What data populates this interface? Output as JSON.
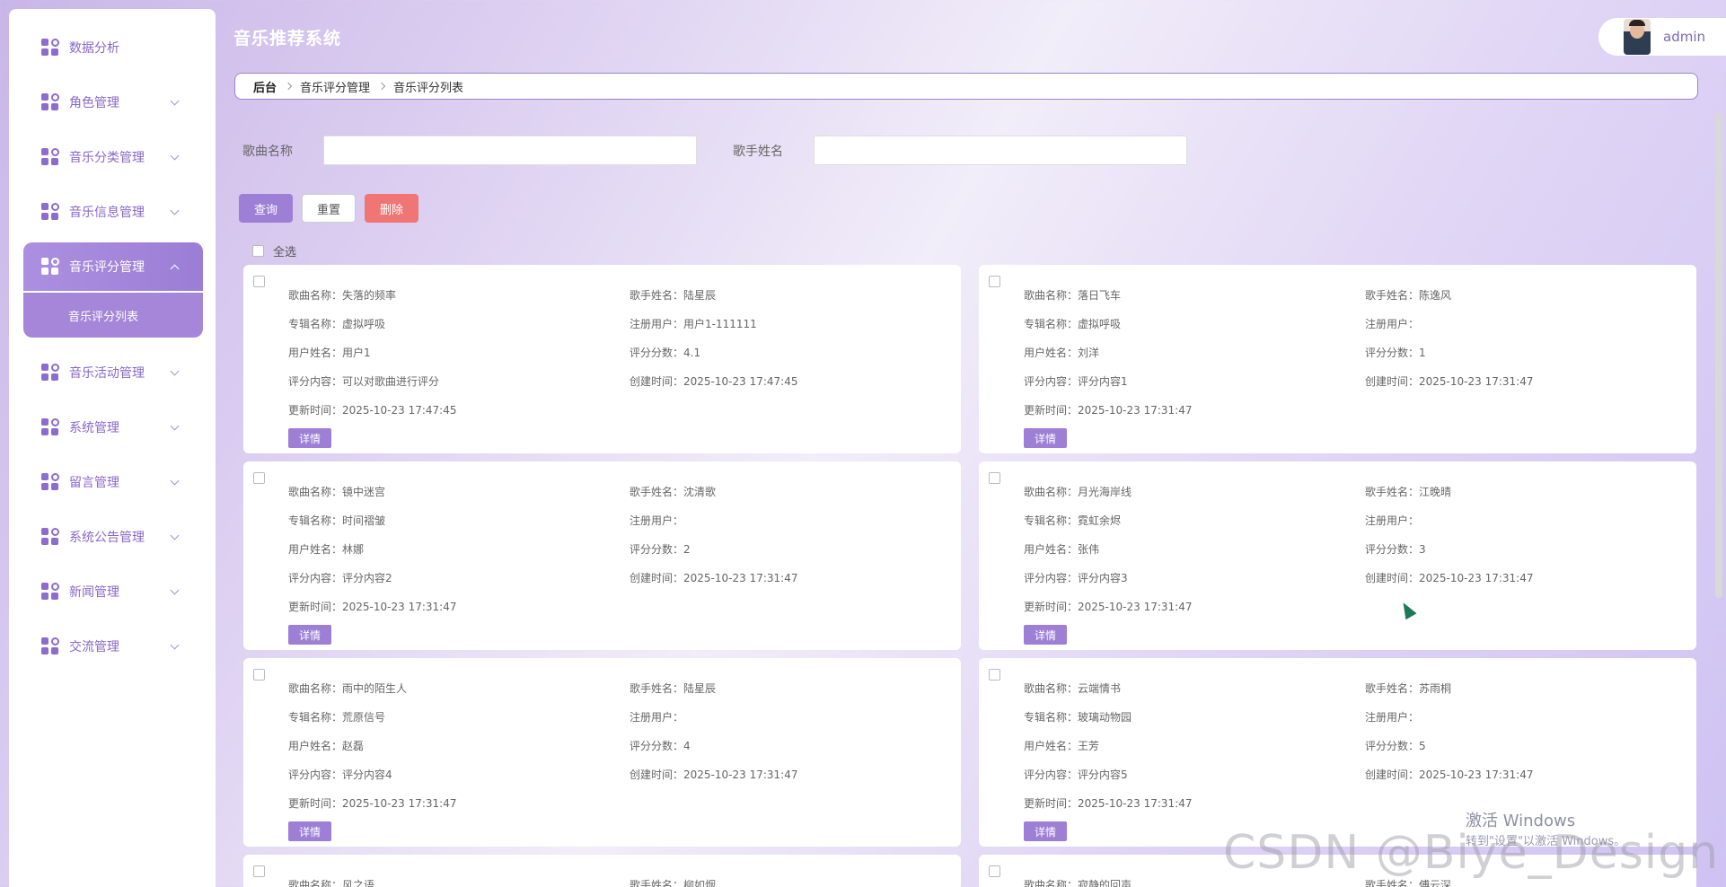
{
  "app": {
    "title": "音乐推荐系统"
  },
  "user": {
    "name": "admin"
  },
  "sidebar": {
    "items": [
      {
        "label": "数据分析",
        "has_chevron": false
      },
      {
        "label": "角色管理",
        "has_chevron": true
      },
      {
        "label": "音乐分类管理",
        "has_chevron": true
      },
      {
        "label": "音乐信息管理",
        "has_chevron": true
      },
      {
        "label": "音乐评分管理",
        "has_chevron": true,
        "active": true,
        "children": [
          "音乐评分列表"
        ]
      },
      {
        "label": "音乐活动管理",
        "has_chevron": true
      },
      {
        "label": "系统管理",
        "has_chevron": true
      },
      {
        "label": "留言管理",
        "has_chevron": true
      },
      {
        "label": "系统公告管理",
        "has_chevron": true
      },
      {
        "label": "新闻管理",
        "has_chevron": true
      },
      {
        "label": "交流管理",
        "has_chevron": true
      }
    ]
  },
  "breadcrumb": {
    "root": "后台",
    "level1": "音乐评分管理",
    "level2": "音乐评分列表"
  },
  "search": {
    "song_label": "歌曲名称",
    "song_value": "",
    "singer_label": "歌手姓名",
    "singer_value": ""
  },
  "buttons": {
    "query": "查询",
    "reset": "重置",
    "delete": "删除",
    "select_all": "全选",
    "detail": "详情"
  },
  "labels": {
    "song": "歌曲名称：",
    "singer": "歌手姓名：",
    "album": "专辑名称：",
    "reg_user": "注册用户：",
    "user_name": "用户姓名：",
    "score": "评分分数：",
    "comment": "评分内容：",
    "created": "创建时间：",
    "updated": "更新时间："
  },
  "records": [
    {
      "song": "失落的频率",
      "singer": "陆星辰",
      "album": "虚拟呼吸",
      "reg_user": "用户1-111111",
      "user_name": "用户1",
      "score": "4.1",
      "comment": "可以对歌曲进行评分",
      "created": "2025-10-23 17:47:45",
      "updated": "2025-10-23 17:47:45"
    },
    {
      "song": "落日飞车",
      "singer": "陈逸风",
      "album": "虚拟呼吸",
      "reg_user": "",
      "user_name": "刘洋",
      "score": "1",
      "comment": "评分内容1",
      "created": "2025-10-23 17:31:47",
      "updated": "2025-10-23 17:31:47"
    },
    {
      "song": "镜中迷宫",
      "singer": "沈清歌",
      "album": "时间褶皱",
      "reg_user": "",
      "user_name": "林娜",
      "score": "2",
      "comment": "评分内容2",
      "created": "2025-10-23 17:31:47",
      "updated": "2025-10-23 17:31:47"
    },
    {
      "song": "月光海岸线",
      "singer": "江晚晴",
      "album": "霓虹余烬",
      "reg_user": "",
      "user_name": "张伟",
      "score": "3",
      "comment": "评分内容3",
      "created": "2025-10-23 17:31:47",
      "updated": "2025-10-23 17:31:47"
    },
    {
      "song": "雨中的陌生人",
      "singer": "陆星辰",
      "album": "荒原信号",
      "reg_user": "",
      "user_name": "赵磊",
      "score": "4",
      "comment": "评分内容4",
      "created": "2025-10-23 17:31:47",
      "updated": "2025-10-23 17:31:47"
    },
    {
      "song": "云端情书",
      "singer": "苏雨桐",
      "album": "玻璃动物园",
      "reg_user": "",
      "user_name": "王芳",
      "score": "5",
      "comment": "评分内容5",
      "created": "2025-10-23 17:31:47",
      "updated": "2025-10-23 17:31:47"
    },
    {
      "song": "风之语",
      "singer": "柳如烟",
      "partial": true
    },
    {
      "song": "寂静的回声",
      "singer": "傅云深",
      "partial": true
    }
  ],
  "watermarks": {
    "win_title": "激活 Windows",
    "win_sub": "转到\"设置\"以激活 Windows。",
    "csdn": "CSDN @Biye_Design"
  }
}
